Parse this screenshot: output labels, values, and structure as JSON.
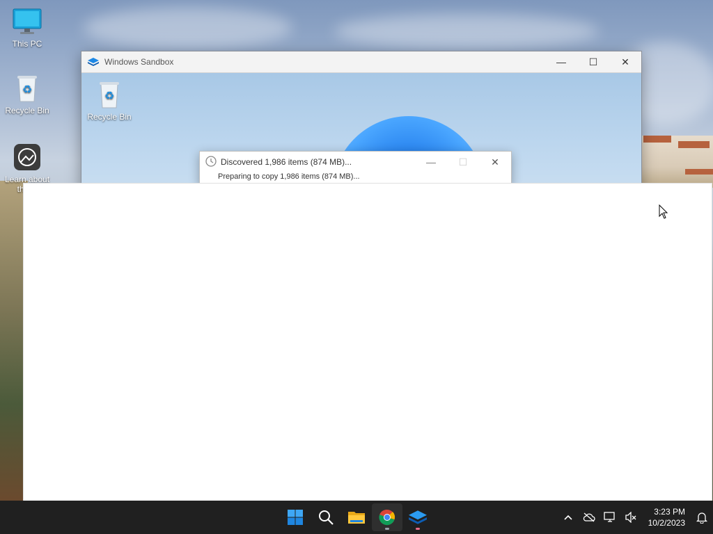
{
  "desktop": {
    "icons": [
      {
        "label": "This PC",
        "icon": "monitor-icon"
      },
      {
        "label": "Recycle Bin",
        "icon": "recycle-bin-icon"
      },
      {
        "label": "Learn about this p",
        "icon": "learn-about-icon"
      }
    ]
  },
  "sandbox_window": {
    "title": "Windows Sandbox",
    "desktop_icon_label": "Recycle Bin"
  },
  "copy_dialog": {
    "title": "Discovered 1,986 items (874 MB)...",
    "subtitle": "Preparing to copy 1,986 items (874 MB)..."
  },
  "taskbar": {
    "apps": [
      {
        "name": "start",
        "icon": "windows-logo-icon"
      },
      {
        "name": "search",
        "icon": "search-icon"
      },
      {
        "name": "file-explorer",
        "icon": "folder-icon"
      },
      {
        "name": "chrome",
        "icon": "chrome-icon",
        "active": true
      },
      {
        "name": "windows-sandbox",
        "icon": "sandbox-icon"
      }
    ],
    "tray": {
      "time": "3:23 PM",
      "date": "10/2/2023"
    }
  },
  "colors": {
    "taskbar_bg": "#202020",
    "accent": "#0078d4"
  }
}
